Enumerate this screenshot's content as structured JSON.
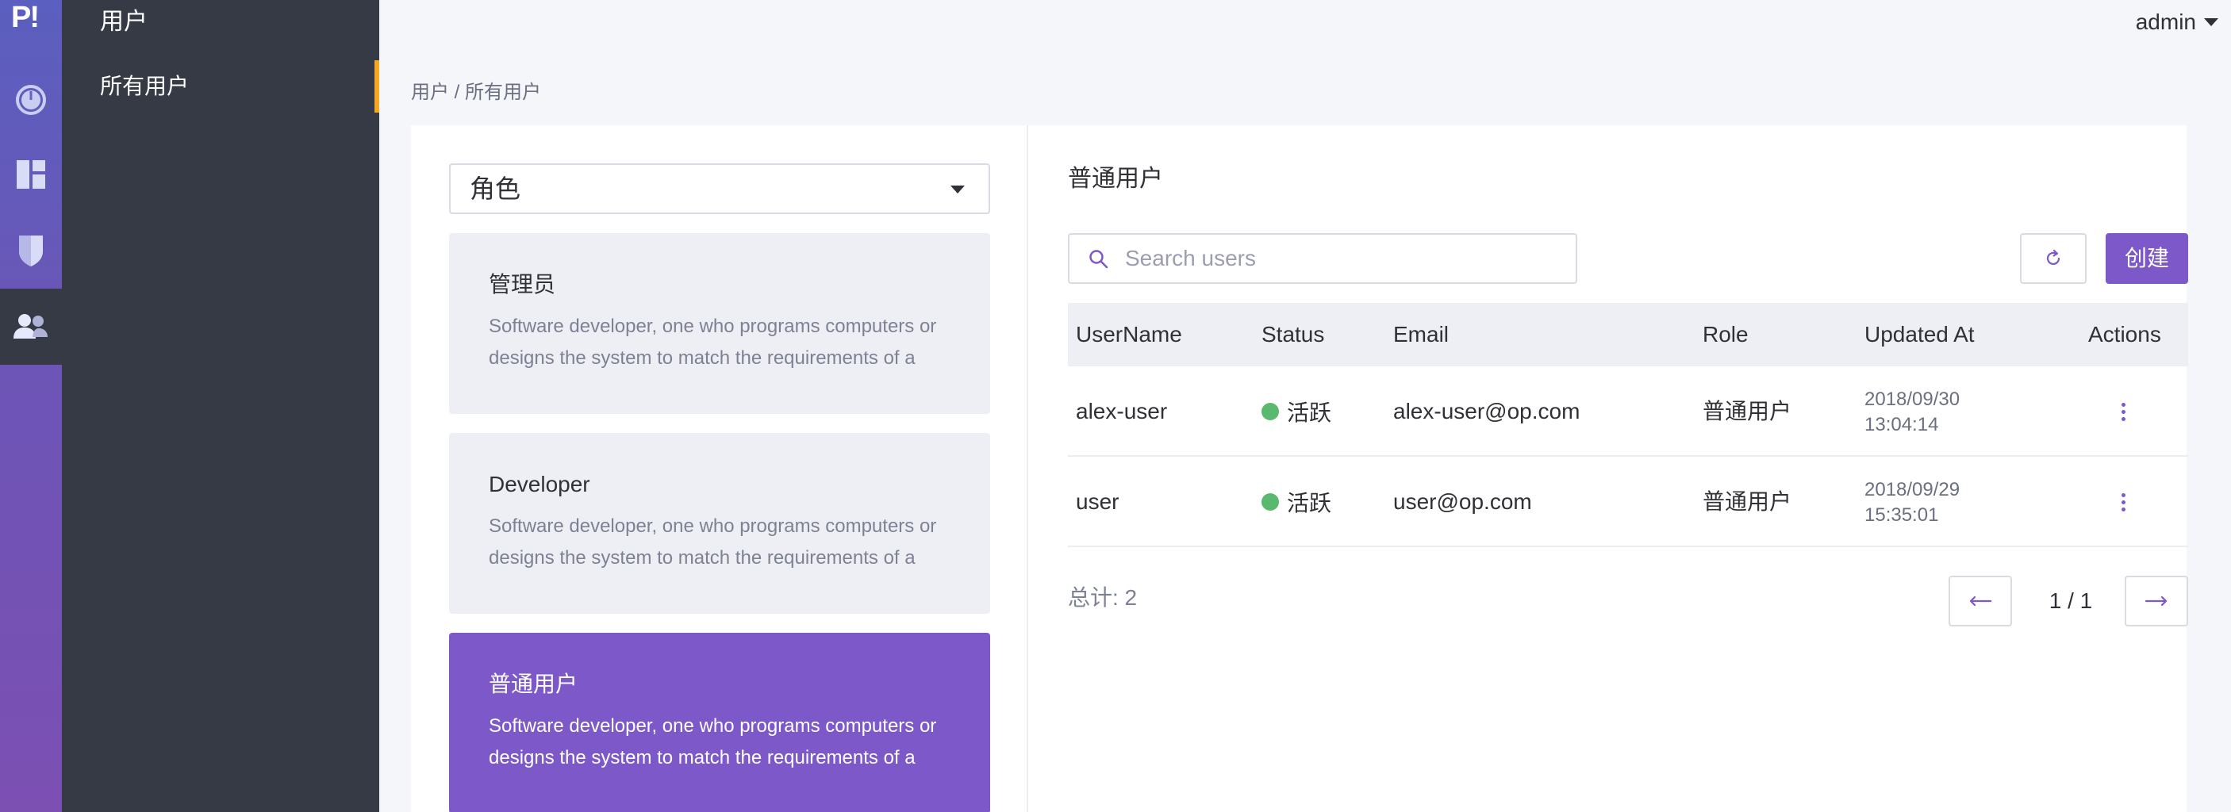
{
  "rail": {
    "logo": "P!",
    "items": [
      {
        "icon": "gauge-icon"
      },
      {
        "icon": "dashboard-icon"
      },
      {
        "icon": "shield-icon"
      },
      {
        "icon": "users-icon",
        "active": true
      }
    ]
  },
  "sidebar": {
    "title": "用户",
    "items": [
      {
        "label": "所有用户",
        "active": true
      }
    ]
  },
  "header": {
    "user": "admin"
  },
  "breadcrumb": "用户 / 所有用户",
  "left": {
    "select_label": "角色",
    "roles": [
      {
        "name": "管理员",
        "desc": "Software developer, one who programs computers or designs the system to match the requirements of a"
      },
      {
        "name": "Developer",
        "desc": "Software developer, one who programs computers or designs the system to match the requirements of a"
      },
      {
        "name": "普通用户",
        "desc": "Software developer, one who programs computers or designs the system to match the requirements of a",
        "active": true
      }
    ]
  },
  "right": {
    "title": "普通用户",
    "search_placeholder": "Search users",
    "create_label": "创建",
    "columns": [
      "UserName",
      "Status",
      "Email",
      "Role",
      "Updated At",
      "Actions"
    ],
    "rows": [
      {
        "username": "alex-user",
        "status": "活跃",
        "email": "alex-user@op.com",
        "role": "普通用户",
        "date": "2018/09/30",
        "time": "13:04:14"
      },
      {
        "username": "user",
        "status": "活跃",
        "email": "user@op.com",
        "role": "普通用户",
        "date": "2018/09/29",
        "time": "15:35:01"
      }
    ],
    "total": "总计: 2",
    "pagination": "1 / 1"
  },
  "colors": {
    "accent": "#7d58c8",
    "sidebar": "#353a45",
    "marker": "#f5a623",
    "status_active": "#58b96f"
  }
}
